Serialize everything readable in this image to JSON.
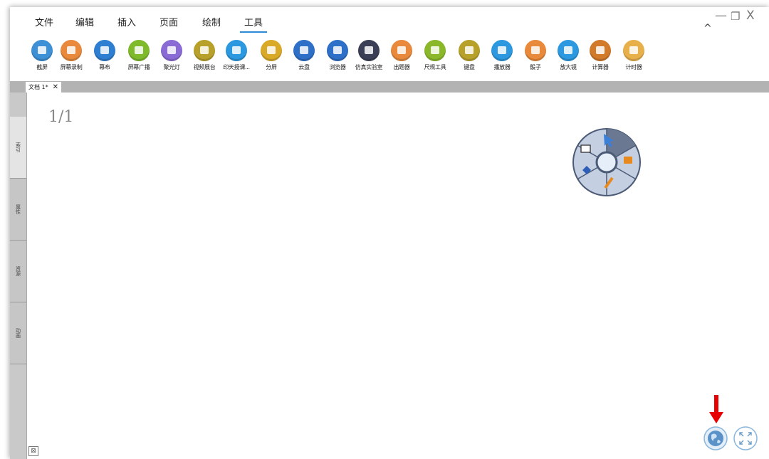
{
  "menu": {
    "items": [
      "文件",
      "编辑",
      "插入",
      "页面",
      "绘制",
      "工具"
    ],
    "active": "工具"
  },
  "window_controls": {
    "minimize": "—",
    "restore": "❐",
    "close": "X",
    "collapse": "^"
  },
  "toolbar": {
    "tools": [
      {
        "label": "截屏",
        "icon": "screenshot-icon",
        "color": "#3d8fd6"
      },
      {
        "label": "屏幕录制",
        "icon": "screen-record-icon",
        "color": "#e8893b"
      },
      {
        "label": "幕布",
        "icon": "curtain-icon",
        "color": "#2e7fd1"
      },
      {
        "label": "屏幕广播",
        "icon": "screen-broadcast-icon",
        "color": "#7fba2a"
      },
      {
        "label": "聚光灯",
        "icon": "spotlight-icon",
        "color": "#8a6bd6"
      },
      {
        "label": "视频展台",
        "icon": "video-booth-icon",
        "color": "#b8a12a"
      },
      {
        "label": "印天授课...",
        "icon": "teaching-icon",
        "color": "#2c98e0"
      },
      {
        "label": "分屏",
        "icon": "split-screen-icon",
        "color": "#d9a928"
      },
      {
        "label": "云盘",
        "icon": "cloud-disk-icon",
        "color": "#2e6fc8"
      },
      {
        "label": "浏览器",
        "icon": "browser-icon",
        "color": "#2e6fc8"
      },
      {
        "label": "仿真实验室",
        "icon": "lab-icon",
        "color": "#3a3f55"
      },
      {
        "label": "出题器",
        "icon": "question-icon",
        "color": "#e8893b"
      },
      {
        "label": "尺规工具",
        "icon": "ruler-icon",
        "color": "#8ab82a"
      },
      {
        "label": "键盘",
        "icon": "keyboard-icon",
        "color": "#b8a12a"
      },
      {
        "label": "播放器",
        "icon": "player-icon",
        "color": "#2c98e0"
      },
      {
        "label": "骰子",
        "icon": "dice-icon",
        "color": "#e8893b"
      },
      {
        "label": "放大镜",
        "icon": "magnifier-icon",
        "color": "#2c98e0"
      },
      {
        "label": "计算器",
        "icon": "calculator-icon",
        "color": "#d07a2a"
      },
      {
        "label": "计时器",
        "icon": "timer-icon",
        "color": "#e8b04a"
      }
    ]
  },
  "document_tab": {
    "label": "文档 1*",
    "close": "✕"
  },
  "side_tabs": [
    "索引",
    "属性",
    "资源",
    "动画"
  ],
  "canvas": {
    "page_indicator": "1/1"
  },
  "colors": {
    "accent": "#2e8bd8",
    "arrow": "#e60000"
  }
}
